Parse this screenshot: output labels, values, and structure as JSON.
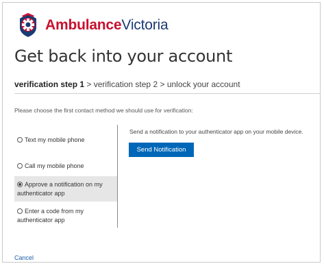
{
  "brand": {
    "name_part1": "Ambulance",
    "name_part2": "Victoria"
  },
  "page": {
    "title": "Get back into your account",
    "breadcrumb": {
      "current": "verification step 1",
      "sep1": " > ",
      "step2": "verification step 2",
      "sep2": " > ",
      "step3": "unlock your account"
    },
    "instruction": "Please choose the first contact method we should use for verification:"
  },
  "options": [
    {
      "label": "Text my mobile phone",
      "selected": false
    },
    {
      "label": "Call my mobile phone",
      "selected": false
    },
    {
      "label": "Approve a notification on my authenticator app",
      "selected": true
    },
    {
      "label": "Enter a code from my authenticator app",
      "selected": false
    }
  ],
  "detail": {
    "text": "Send a notification to your authenticator app on your mobile device.",
    "button_label": "Send Notification"
  },
  "footer": {
    "cancel_label": "Cancel"
  },
  "colors": {
    "brand_red": "#c8102e",
    "brand_navy": "#1a3b73",
    "button": "#0067b8",
    "link": "#1a5fa8"
  }
}
